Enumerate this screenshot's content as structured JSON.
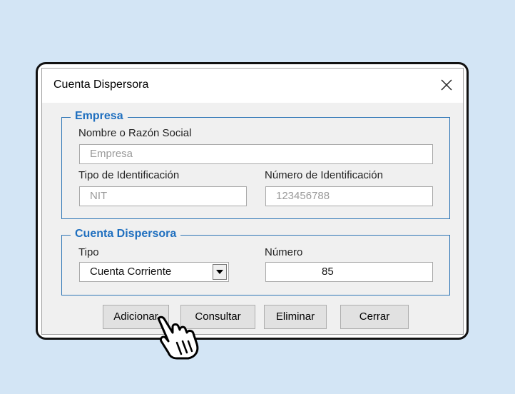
{
  "dialog": {
    "title": "Cuenta Dispersora",
    "close_icon": "close-icon"
  },
  "empresa": {
    "legend": "Empresa",
    "nombre_label": "Nombre o Razón Social",
    "nombre_value": "Empresa",
    "tipo_id_label": "Tipo de Identificación",
    "tipo_id_value": "NIT",
    "numero_id_label": "Número  de Identificación",
    "numero_id_value": "123456788"
  },
  "cuenta": {
    "legend": "Cuenta Dispersora",
    "tipo_label": "Tipo",
    "tipo_value": "Cuenta Corriente",
    "numero_label": "Número",
    "numero_value": "85"
  },
  "buttons": {
    "adicionar": "Adicionar",
    "consultar": "Consultar",
    "eliminar": "Eliminar",
    "cerrar": "Cerrar"
  },
  "colors": {
    "accent": "#1f6fbf",
    "background": "#d3e5f5"
  }
}
